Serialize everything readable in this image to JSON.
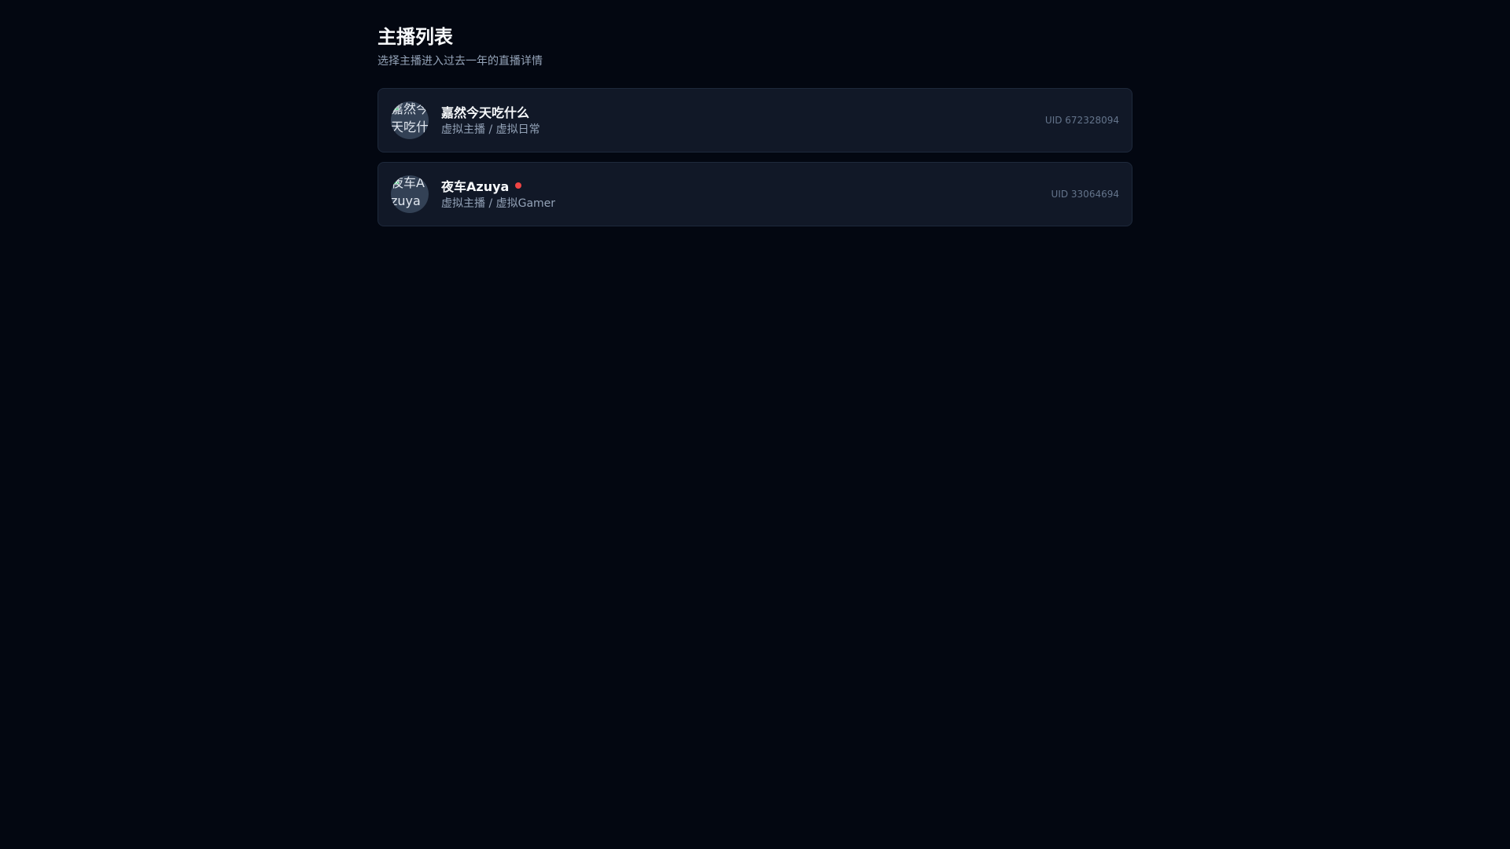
{
  "page": {
    "title": "主播列表",
    "subtitle": "选择主播进入过去一年的直播详情"
  },
  "streamers": [
    {
      "name": "嘉然今天吃什么",
      "avatar_alt": "嘉然今天吃什么",
      "tags": "虚拟主播 / 虚拟日常",
      "uid": "UID 672328094",
      "live": false
    },
    {
      "name": "夜车Azuya",
      "avatar_alt": "夜车Azuya",
      "tags": "虚拟主播 / 虚拟Gamer",
      "uid": "UID 33064694",
      "live": true
    }
  ],
  "colors": {
    "background": "#030711",
    "card": "#111827",
    "live_indicator": "#ef4444"
  }
}
